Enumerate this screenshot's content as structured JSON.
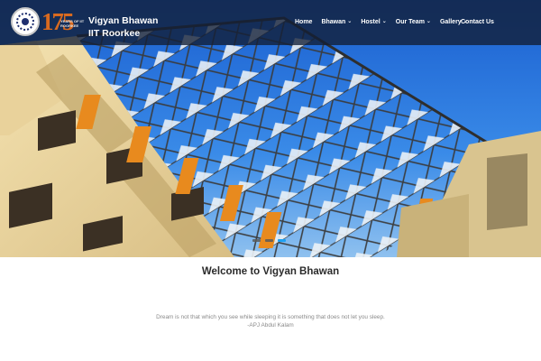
{
  "brand": {
    "title_line1": "Vigyan Bhawan",
    "title_line2": "IIT Roorkee",
    "anniversary_number": "175",
    "anniversary_text": "YEARS OF IIT ROORKEE"
  },
  "nav": {
    "items": [
      {
        "label": "Home",
        "has_dropdown": false
      },
      {
        "label": "Bhawan",
        "has_dropdown": true
      },
      {
        "label": "Hostel",
        "has_dropdown": true
      },
      {
        "label": "Our Team",
        "has_dropdown": true
      },
      {
        "label": "Gallery",
        "has_dropdown": true
      },
      {
        "label": "Contact Us",
        "has_dropdown": false
      }
    ],
    "chevron": "⌄"
  },
  "hero": {
    "image": "hostel-building-glass-roof",
    "slide_count": 3,
    "active_slide": 3,
    "accent_color": "#1da1f2"
  },
  "content": {
    "welcome_heading": "Welcome to Vigyan Bhawan",
    "quote_text": "Dream is not that which you see while sleeping it is something that does not let you sleep.",
    "quote_author": "-APJ Abdul Kalam"
  }
}
